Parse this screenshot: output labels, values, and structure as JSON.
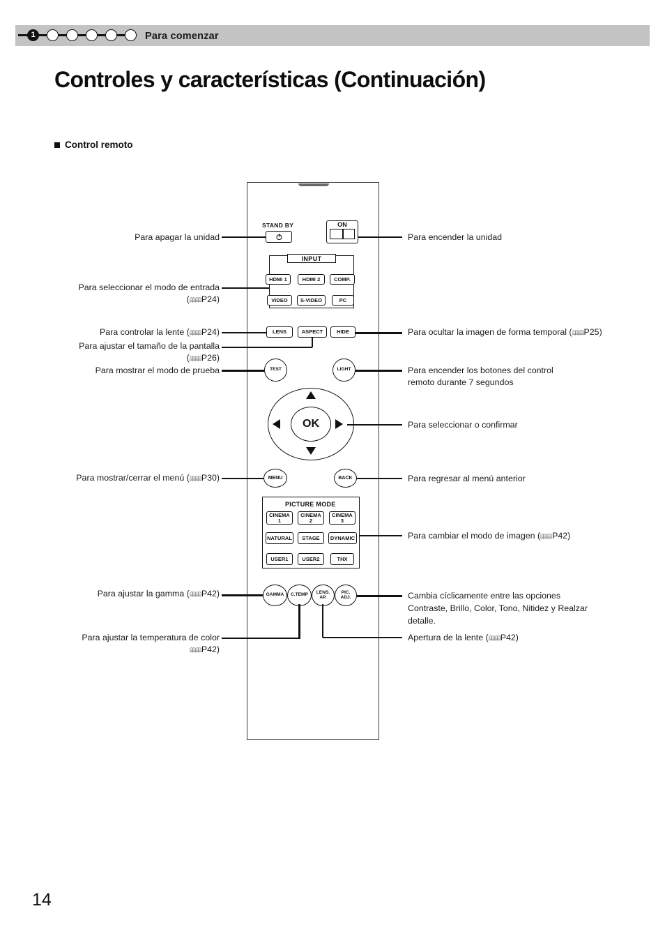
{
  "header": {
    "chapter_label": "Para comenzar",
    "active_step": "1",
    "total_steps": 6
  },
  "page": {
    "title": "Controles y características (Continuación)",
    "section_heading": "Control remoto",
    "page_number": "14"
  },
  "remote": {
    "standby_caption": "STAND BY",
    "power_icon": "power-icon",
    "on_caption": "ON",
    "input_group_label": "INPUT",
    "input_keys": [
      "HDMI 1",
      "HDMI 2",
      "COMP.",
      "VIDEO",
      "S-VIDEO",
      "PC"
    ],
    "lens_key": "LENS",
    "aspect_key": "ASPECT",
    "hide_key": "HIDE",
    "test_key": "TEST",
    "light_key": "LIGHT",
    "ok_key": "OK",
    "menu_key": "MENU",
    "back_key": "BACK",
    "picture_mode_label": "PICTURE MODE",
    "picture_mode_keys": [
      {
        "line1": "CINEMA",
        "line2": "1"
      },
      {
        "line1": "CINEMA",
        "line2": "2"
      },
      {
        "line1": "CINEMA",
        "line2": "3"
      },
      {
        "line1": "NATURAL",
        "line2": ""
      },
      {
        "line1": "STAGE",
        "line2": ""
      },
      {
        "line1": "DYNAMIC",
        "line2": ""
      },
      {
        "line1": "USER1",
        "line2": ""
      },
      {
        "line1": "USER2",
        "line2": ""
      },
      {
        "line1": "THX",
        "line2": ""
      }
    ],
    "bottom_keys": [
      {
        "line1": "GAMMA",
        "line2": ""
      },
      {
        "line1": "C.TEMP",
        "line2": ""
      },
      {
        "line1": "LENS.",
        "line2": "AP."
      },
      {
        "line1": "PIC.",
        "line2": "ADJ."
      }
    ]
  },
  "annotations": {
    "left": {
      "power_off": "Para apagar la unidad",
      "input_mode_l1": "Para seleccionar el modo de entrada",
      "input_mode_l2_ref": "P24",
      "lens_control": "Para controlar la lente (",
      "lens_control_ref": "P24",
      "lens_control_tail": ")",
      "screen_size_l1": "Para ajustar el tamaño de la pantalla",
      "screen_size_l2_ref": "P26",
      "test_pattern": "Para mostrar el modo de prueba",
      "menu_toggle": "Para mostrar/cerrar el menú (",
      "menu_toggle_ref": "P30",
      "menu_toggle_tail": ")",
      "gamma": "Para ajustar la gamma (",
      "gamma_ref": "P42",
      "gamma_tail": ")",
      "color_temp_l1": "Para ajustar la temperatura de color",
      "color_temp_l2_ref": "P42"
    },
    "right": {
      "power_on": "Para encender la unidad",
      "hide_image": "Para ocultar la imagen de forma temporal (",
      "hide_image_ref": "P25",
      "hide_image_tail": ")",
      "light_l1": "Para encender los botones del control",
      "light_l2": "remoto durante 7 segundos",
      "ok_confirm": "Para seleccionar o confirmar",
      "back_menu": "Para regresar al menú anterior",
      "picture_mode": "Para cambiar el modo de imagen (",
      "picture_mode_ref": "P42",
      "picture_mode_tail": ")",
      "pic_adj_l1": "Cambia cíclicamente entre las opciones",
      "pic_adj_l2": "Contraste, Brillo, Color, Tono, Nitidez y Realzar",
      "pic_adj_l3": "detalle.",
      "lens_aperture": "Apertura de la lente (",
      "lens_aperture_ref": "P42",
      "lens_aperture_tail": ")"
    }
  },
  "colors": {
    "header_band": "#c3c3c3",
    "ink": "#111111",
    "page_bg": "#ffffff"
  }
}
